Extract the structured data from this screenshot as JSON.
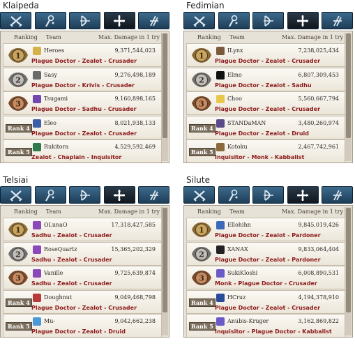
{
  "header": {
    "ranking": "Ranking",
    "team": "Team",
    "damage": "Max. Damage in 1 try"
  },
  "rank_labels": [
    "1",
    "2",
    "3",
    "Rank 4",
    "Rank 5"
  ],
  "panels": [
    {
      "server": "Klaipeda",
      "rows": [
        {
          "team": "Heroes",
          "damage": "9,371,544,023",
          "classes": "Plague Doctor - Zealot - Crusader",
          "icon_color": "#d6b04a"
        },
        {
          "team": "Sasy",
          "damage": "9,276,498,189",
          "classes": "Plague Doctor - Krivis - Crusader",
          "icon_color": "#6a6a6a"
        },
        {
          "team": "Tsugami",
          "damage": "9,160,898,165",
          "classes": "Plague Doctor - Sadhu - Crusader",
          "icon_color": "#7048b0"
        },
        {
          "team": "Eleo",
          "damage": "8,021,938,133",
          "classes": "Plague Doctor - Zealot - Crusader",
          "icon_color": "#3a5fa8"
        },
        {
          "team": "Rukitora",
          "damage": "4,529,592,469",
          "classes": "Zealot - Chaplain - Inquisitor",
          "icon_color": "#2f7a4a"
        }
      ]
    },
    {
      "server": "Fedimian",
      "rows": [
        {
          "team": "ILynx",
          "damage": "7,238,025,434",
          "classes": "Plague Doctor - Zealot - Crusader",
          "icon_color": "#7a5a3a"
        },
        {
          "team": "Elmo",
          "damage": "6,807,309,453",
          "classes": "Plague Doctor - Zealot - Sadhu",
          "icon_color": "#111111"
        },
        {
          "team": "Choo",
          "damage": "5,560,667,794",
          "classes": "Plague Doctor - Zealot - Crusader",
          "icon_color": "#e8c84a"
        },
        {
          "team": "STANDaMAN",
          "damage": "3,480,260,974",
          "classes": "Plague Doctor - Zealot - Druid",
          "icon_color": "#5a4a8a"
        },
        {
          "team": "Kotoku",
          "damage": "2,467,742,961",
          "classes": "Inquisitor - Monk - Kabbalist",
          "icon_color": "#8a6a3a"
        }
      ]
    },
    {
      "server": "Telsiai",
      "rows": [
        {
          "team": "OLunaO",
          "damage": "17,318,427,585",
          "classes": "Sadhu - Zealot - Crusader",
          "icon_color": "#8a48b8"
        },
        {
          "team": "RoseQuartz",
          "damage": "15,365,202,329",
          "classes": "Sadhu - Zealot - Crusader",
          "icon_color": "#8a48b8"
        },
        {
          "team": "Vanille",
          "damage": "9,725,639,874",
          "classes": "Sadhu - Zealot - Crusader",
          "icon_color": "#8a48b8"
        },
        {
          "team": "Doughnut",
          "damage": "9,049,468,798",
          "classes": "Plague Doctor - Zealot - Crusader",
          "icon_color": "#b83a3a"
        },
        {
          "team": "Mu-",
          "damage": "9,042,662,238",
          "classes": "Plague Doctor - Zealot - Druid",
          "icon_color": "#4a9ad8"
        }
      ]
    },
    {
      "server": "Silute",
      "rows": [
        {
          "team": "Ellohihn",
          "damage": "9,845,019,426",
          "classes": "Plague Doctor - Zealot - Pardoner",
          "icon_color": "#3a6ab8"
        },
        {
          "team": "XANAX",
          "damage": "9,833,064,404",
          "classes": "Plague Doctor - Zealot - Pardoner",
          "icon_color": "#222222"
        },
        {
          "team": "SukiKloshi",
          "damage": "6,008,890,531",
          "classes": "Monk - Plague Doctor - Crusader",
          "icon_color": "#6a5ac8"
        },
        {
          "team": "HCruz",
          "damage": "4,194,378,910",
          "classes": "Plague Doctor - Zealot - Crusader",
          "icon_color": "#2a4a9a"
        },
        {
          "team": "Anubis-Kruger",
          "damage": "3,162,869,822",
          "classes": "Inquisitor - Plague Doctor - Kabbalist",
          "icon_color": "#6a5ac8"
        }
      ]
    }
  ],
  "tabs": [
    {
      "name": "sword-tab",
      "icon": "crossed-swords-icon",
      "active": false
    },
    {
      "name": "magic-tab",
      "icon": "magic-staff-icon",
      "active": false
    },
    {
      "name": "bow-tab",
      "icon": "bow-icon",
      "active": false
    },
    {
      "name": "cleric-tab",
      "icon": "cross-icon",
      "active": true
    },
    {
      "name": "scout-tab",
      "icon": "scout-icon",
      "active": false
    }
  ],
  "colors": {
    "class_text": "#8c1a1a",
    "tab_bg": "#2d5677",
    "board_bg": "#e7e2d8"
  }
}
